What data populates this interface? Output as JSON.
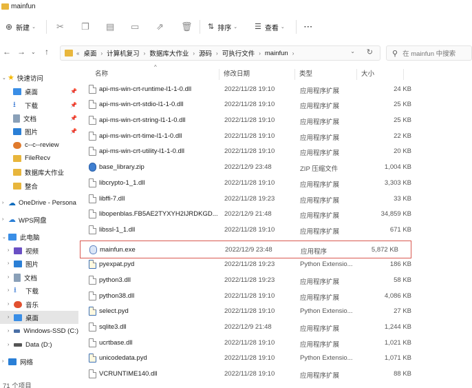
{
  "window": {
    "title": "mainfun"
  },
  "toolbar": {
    "new_label": "新建",
    "sort_label": "排序",
    "view_label": "查看",
    "more_label": "···"
  },
  "address": {
    "overflow": "«",
    "crumbs": [
      "桌面",
      "计算机复习",
      "数据库大作业",
      "源码",
      "可执行文件",
      "mainfun"
    ]
  },
  "search": {
    "placeholder": "在 mainfun 中搜索"
  },
  "sidebar": {
    "items": [
      {
        "label": "快速访问",
        "icon": "star-icon",
        "color": "#f5b800"
      },
      {
        "label": "桌面",
        "icon": "desktop-icon",
        "color": "#3a8ee6"
      },
      {
        "label": "下载",
        "icon": "download-icon",
        "color": "#2a6fd1"
      },
      {
        "label": "文档",
        "icon": "document-icon",
        "color": "#8aa0b8"
      },
      {
        "label": "图片",
        "icon": "pictures-icon",
        "color": "#2a7fd6"
      },
      {
        "label": "c--c--review",
        "icon": "folder-icon",
        "color": "#e07a2c"
      },
      {
        "label": "FileRecv",
        "icon": "folder-icon",
        "color": "#e8b63c"
      },
      {
        "label": "数据库大作业",
        "icon": "folder-icon",
        "color": "#e8b63c"
      },
      {
        "label": "整合",
        "icon": "folder-icon",
        "color": "#e8b63c"
      },
      {
        "label": "OneDrive - Persona",
        "icon": "onedrive-icon",
        "color": "#0f6cbd"
      },
      {
        "label": "WPS网盘",
        "icon": "cloud-icon",
        "color": "#2a7fd6"
      },
      {
        "label": "此电脑",
        "icon": "computer-icon",
        "color": "#3a8ee6"
      },
      {
        "label": "视频",
        "icon": "video-icon",
        "color": "#6a4fc4"
      },
      {
        "label": "图片",
        "icon": "pictures-icon",
        "color": "#2a7fd6"
      },
      {
        "label": "文档",
        "icon": "document-icon",
        "color": "#8aa0b8"
      },
      {
        "label": "下载",
        "icon": "download-icon",
        "color": "#2a6fd1"
      },
      {
        "label": "音乐",
        "icon": "music-icon",
        "color": "#e2502f"
      },
      {
        "label": "桌面",
        "icon": "desktop-icon",
        "color": "#3a8ee6"
      },
      {
        "label": "Windows-SSD (C:)",
        "icon": "drive-icon",
        "color": "#4a6fa5"
      },
      {
        "label": "Data (D:)",
        "icon": "drive-icon",
        "color": "#555555"
      },
      {
        "label": "网络",
        "icon": "network-icon",
        "color": "#2a7fd6"
      }
    ]
  },
  "columns": {
    "name": "名称",
    "date": "修改日期",
    "type": "类型",
    "size": "大小"
  },
  "files": [
    {
      "name": "api-ms-win-crt-runtime-l1-1-0.dll",
      "date": "2022/11/28 19:10",
      "type": "应用程序扩展",
      "size": "24 KB",
      "icon": "dll-icon"
    },
    {
      "name": "api-ms-win-crt-stdio-l1-1-0.dll",
      "date": "2022/11/28 19:10",
      "type": "应用程序扩展",
      "size": "25 KB",
      "icon": "dll-icon"
    },
    {
      "name": "api-ms-win-crt-string-l1-1-0.dll",
      "date": "2022/11/28 19:10",
      "type": "应用程序扩展",
      "size": "25 KB",
      "icon": "dll-icon"
    },
    {
      "name": "api-ms-win-crt-time-l1-1-0.dll",
      "date": "2022/11/28 19:10",
      "type": "应用程序扩展",
      "size": "22 KB",
      "icon": "dll-icon"
    },
    {
      "name": "api-ms-win-crt-utility-l1-1-0.dll",
      "date": "2022/11/28 19:10",
      "type": "应用程序扩展",
      "size": "20 KB",
      "icon": "dll-icon"
    },
    {
      "name": "base_library.zip",
      "date": "2022/12/9 23:48",
      "type": "ZIP 压缩文件",
      "size": "1,004 KB",
      "icon": "zip-icon"
    },
    {
      "name": "libcrypto-1_1.dll",
      "date": "2022/11/28 19:10",
      "type": "应用程序扩展",
      "size": "3,303 KB",
      "icon": "dll-icon"
    },
    {
      "name": "libffi-7.dll",
      "date": "2022/11/28 19:23",
      "type": "应用程序扩展",
      "size": "33 KB",
      "icon": "dll-icon"
    },
    {
      "name": "libopenblas.FB5AE2TYXYH2IJRDKGD...",
      "date": "2022/12/9 21:48",
      "type": "应用程序扩展",
      "size": "34,859 KB",
      "icon": "dll-icon"
    },
    {
      "name": "libssl-1_1.dll",
      "date": "2022/11/28 19:10",
      "type": "应用程序扩展",
      "size": "671 KB",
      "icon": "dll-icon"
    },
    {
      "name": "mainfun.exe",
      "date": "2022/12/9 23:48",
      "type": "应用程序",
      "size": "5,872 KB",
      "icon": "exe-icon",
      "highlighted": true
    },
    {
      "name": "pyexpat.pyd",
      "date": "2022/11/28 19:23",
      "type": "Python Extensio...",
      "size": "186 KB",
      "icon": "pyd-icon"
    },
    {
      "name": "python3.dll",
      "date": "2022/11/28 19:23",
      "type": "应用程序扩展",
      "size": "58 KB",
      "icon": "dll-icon"
    },
    {
      "name": "python38.dll",
      "date": "2022/11/28 19:10",
      "type": "应用程序扩展",
      "size": "4,086 KB",
      "icon": "dll-icon"
    },
    {
      "name": "select.pyd",
      "date": "2022/11/28 19:10",
      "type": "Python Extensio...",
      "size": "27 KB",
      "icon": "pyd-icon"
    },
    {
      "name": "sqlite3.dll",
      "date": "2022/12/9 21:48",
      "type": "应用程序扩展",
      "size": "1,244 KB",
      "icon": "dll-icon"
    },
    {
      "name": "ucrtbase.dll",
      "date": "2022/11/28 19:10",
      "type": "应用程序扩展",
      "size": "1,021 KB",
      "icon": "dll-icon"
    },
    {
      "name": "unicodedata.pyd",
      "date": "2022/11/28 19:10",
      "type": "Python Extensio...",
      "size": "1,071 KB",
      "icon": "pyd-icon"
    },
    {
      "name": "VCRUNTIME140.dll",
      "date": "2022/11/28 19:10",
      "type": "应用程序扩展",
      "size": "88 KB",
      "icon": "dll-icon"
    }
  ],
  "status": {
    "count": "71 个项目"
  },
  "colors": {
    "highlight_border": "#d9574f",
    "folder": "#e8b63c",
    "selected_nav": "#e5e5e5"
  }
}
